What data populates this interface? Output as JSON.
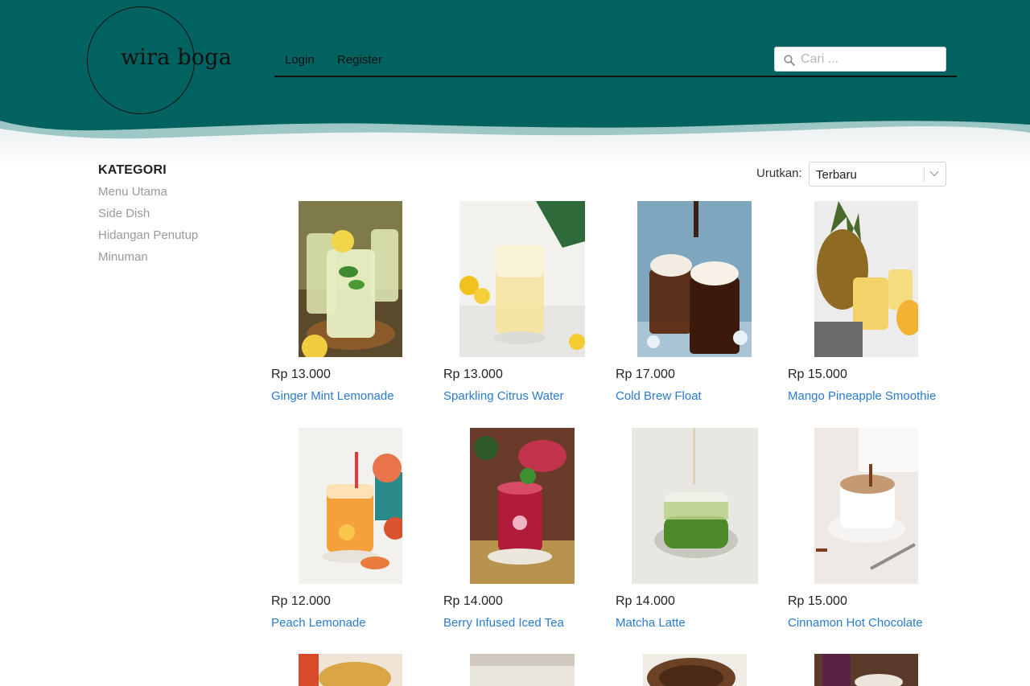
{
  "header": {
    "logo_text": "wira boga",
    "nav": {
      "login": "Login",
      "register": "Register"
    },
    "search": {
      "placeholder": "Cari ...",
      "value": ""
    },
    "colors": {
      "teal": "#02625f",
      "wave_light": "#8fbfbd"
    }
  },
  "sidebar": {
    "title": "KATEGORI",
    "items": [
      {
        "label": "Menu Utama"
      },
      {
        "label": "Side Dish"
      },
      {
        "label": "Hidangan Penutup"
      },
      {
        "label": "Minuman"
      }
    ]
  },
  "sort": {
    "label": "Urutkan:",
    "selected": "Terbaru"
  },
  "products": [
    {
      "price": "Rp 13.000",
      "name": "Ginger Mint Lemonade"
    },
    {
      "price": "Rp 13.000",
      "name": "Sparkling Citrus Water"
    },
    {
      "price": "Rp 17.000",
      "name": "Cold Brew Float"
    },
    {
      "price": "Rp 15.000",
      "name": "Mango Pineapple Smoothie"
    },
    {
      "price": "Rp 12.000",
      "name": "Peach Lemonade"
    },
    {
      "price": "Rp 14.000",
      "name": "Berry Infused Iced Tea"
    },
    {
      "price": "Rp 14.000",
      "name": "Matcha Latte"
    },
    {
      "price": "Rp 15.000",
      "name": "Cinnamon Hot Chocolate"
    }
  ]
}
